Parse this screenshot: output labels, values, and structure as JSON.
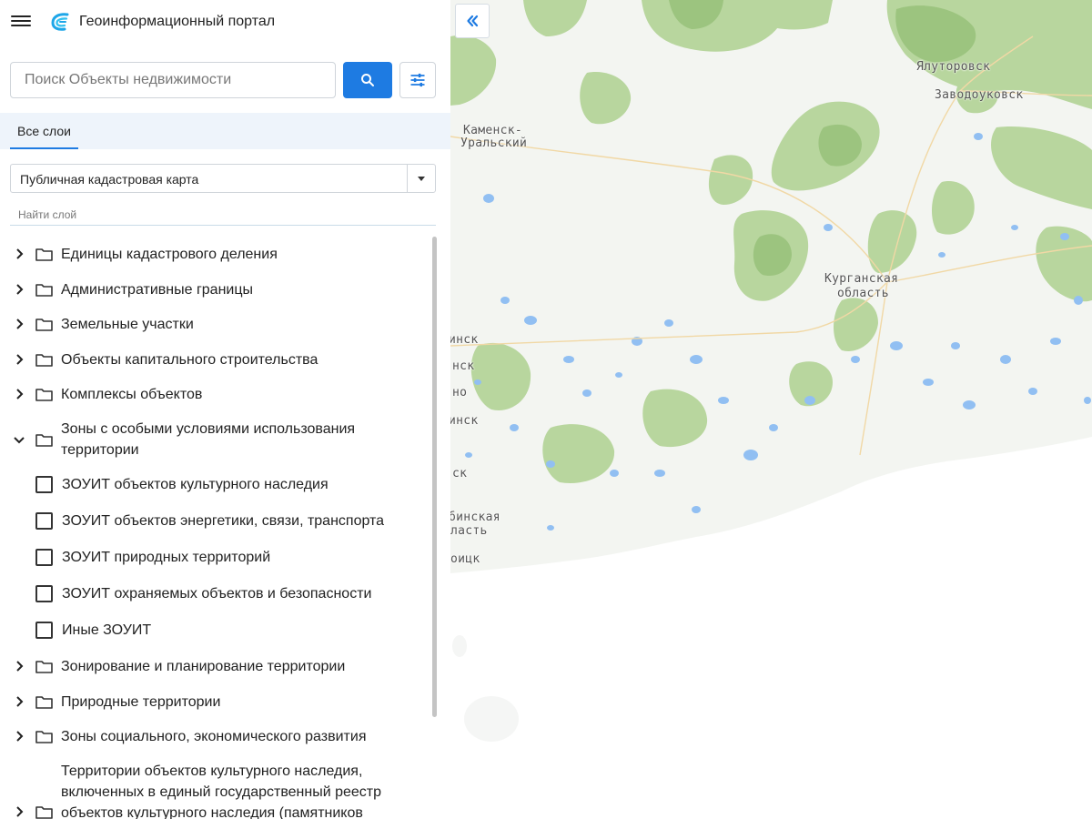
{
  "header": {
    "title": "Геоинформационный портал"
  },
  "search": {
    "placeholder": "Поиск Объекты недвижимости"
  },
  "tabs": [
    {
      "label": "Все слои"
    }
  ],
  "layer_select": {
    "value": "Публичная кадастровая карта"
  },
  "layer_search": {
    "placeholder": "Найти слой"
  },
  "tree": {
    "items": [
      "Единицы кадастрового деления",
      "Административные границы",
      "Земельные участки",
      "Объекты капитального строительства",
      "Комплексы объектов",
      "Зоны с особыми условиями использования территории",
      "Зонирование и планирование территории",
      "Природные территории",
      "Зоны социального, экономического развития",
      "Территории объектов культурного наследия, включенных в единый государственный реестр объектов культурного наследия (памятников"
    ],
    "sub_items": [
      "ЗОУИТ объектов культурного наследия",
      "ЗОУИТ объектов энергетики, связи, транспорта",
      "ЗОУИТ природных территорий",
      "ЗОУИТ охраняемых объектов и безопасности",
      "Иные ЗОУИТ"
    ]
  },
  "map": {
    "labels": {
      "yalutorovsk": "Ялуторовск",
      "zavodoukovsk": "Заводоуковск",
      "kamensk_1": "Каменск-",
      "kamensk_2": "Уральский",
      "kurgan_1": "Курганская",
      "kurgan_2": "область",
      "edge_1": "инск",
      "edge_2": "нск",
      "edge_3": "но",
      "edge_4": "инск",
      "edge_5": "ск",
      "edge_6": "бинская",
      "edge_7": "ласть",
      "edge_8": "оицк"
    }
  },
  "colors": {
    "accent": "#1e7be2",
    "forest": "#b5d49a",
    "forest_dark": "#9cc47f",
    "water": "#8fbdf2",
    "terrain": "#f2f4f0",
    "roads": "#f3d9a8"
  }
}
